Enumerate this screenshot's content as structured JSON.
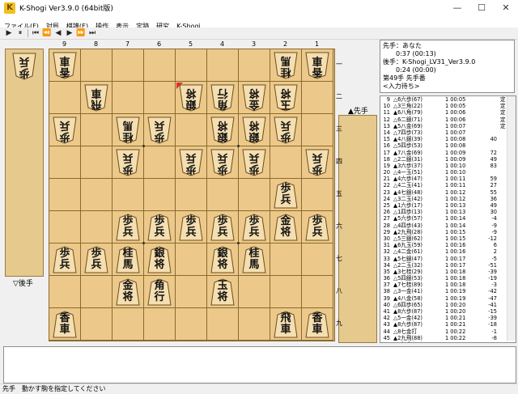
{
  "window": {
    "title": "K-Shogi Ver3.9.0 (64bit版)",
    "icon_letter": "K",
    "minimize": "—",
    "maximize": "☐",
    "close": "✕"
  },
  "menu": [
    "ファイル(F)",
    "対局",
    "棋譜(E)",
    "操作",
    "表示",
    "定跡",
    "研究",
    "K-Shogi"
  ],
  "toolbar": {
    "icons": [
      "play-icon",
      "pause-icon",
      "skip-first-icon",
      "fast-back-icon",
      "step-back-icon",
      "step-forward-icon",
      "fast-forward-icon",
      "skip-last-icon"
    ],
    "glyphs": [
      "▶",
      "⏸",
      "⏮",
      "⏪",
      "◀",
      "▶",
      "⏩",
      "⏭"
    ]
  },
  "board": {
    "file_labels": [
      "9",
      "8",
      "7",
      "6",
      "5",
      "4",
      "3",
      "2",
      "1"
    ],
    "rank_labels": [
      "一",
      "二",
      "三",
      "四",
      "五",
      "六",
      "七",
      "八",
      "九"
    ],
    "pieces": [
      {
        "f": 9,
        "r": 1,
        "c": "香",
        "l": "車",
        "side": "gote"
      },
      {
        "f": 2,
        "r": 1,
        "c": "桂",
        "l": "馬",
        "side": "gote"
      },
      {
        "f": 1,
        "r": 1,
        "c": "香",
        "l": "車",
        "side": "gote"
      },
      {
        "f": 8,
        "r": 2,
        "c": "飛",
        "l": "車",
        "side": "gote"
      },
      {
        "f": 5,
        "r": 2,
        "c": "銀",
        "l": "将",
        "side": "gote"
      },
      {
        "f": 4,
        "r": 2,
        "c": "角",
        "l": "行",
        "side": "gote"
      },
      {
        "f": 3,
        "r": 2,
        "c": "金",
        "l": "将",
        "side": "gote"
      },
      {
        "f": 2,
        "r": 2,
        "c": "玉",
        "l": "将",
        "side": "gote"
      },
      {
        "f": 9,
        "r": 3,
        "c": "歩",
        "l": "兵",
        "side": "gote"
      },
      {
        "f": 7,
        "r": 3,
        "c": "桂",
        "l": "馬",
        "side": "gote"
      },
      {
        "f": 6,
        "r": 3,
        "c": "歩",
        "l": "兵",
        "side": "gote"
      },
      {
        "f": 4,
        "r": 3,
        "c": "銀",
        "l": "将",
        "side": "gote"
      },
      {
        "f": 3,
        "r": 3,
        "c": "銀",
        "l": "将",
        "side": "gote"
      },
      {
        "f": 2,
        "r": 3,
        "c": "歩",
        "l": "兵",
        "side": "gote"
      },
      {
        "f": 7,
        "r": 4,
        "c": "歩",
        "l": "兵",
        "side": "gote"
      },
      {
        "f": 5,
        "r": 4,
        "c": "歩",
        "l": "兵",
        "side": "gote"
      },
      {
        "f": 4,
        "r": 4,
        "c": "歩",
        "l": "兵",
        "side": "gote"
      },
      {
        "f": 3,
        "r": 4,
        "c": "歩",
        "l": "兵",
        "side": "gote"
      },
      {
        "f": 1,
        "r": 4,
        "c": "歩",
        "l": "兵",
        "side": "gote"
      },
      {
        "f": 2,
        "r": 5,
        "c": "歩",
        "l": "兵",
        "side": "sente"
      },
      {
        "f": 7,
        "r": 6,
        "c": "歩",
        "l": "兵",
        "side": "sente"
      },
      {
        "f": 6,
        "r": 6,
        "c": "歩",
        "l": "兵",
        "side": "sente"
      },
      {
        "f": 5,
        "r": 6,
        "c": "歩",
        "l": "兵",
        "side": "sente"
      },
      {
        "f": 4,
        "r": 6,
        "c": "歩",
        "l": "兵",
        "side": "sente"
      },
      {
        "f": 3,
        "r": 6,
        "c": "歩",
        "l": "兵",
        "side": "sente"
      },
      {
        "f": 2,
        "r": 6,
        "c": "金",
        "l": "将",
        "side": "sente"
      },
      {
        "f": 1,
        "r": 6,
        "c": "歩",
        "l": "兵",
        "side": "sente"
      },
      {
        "f": 9,
        "r": 7,
        "c": "歩",
        "l": "兵",
        "side": "sente"
      },
      {
        "f": 8,
        "r": 7,
        "c": "歩",
        "l": "兵",
        "side": "sente"
      },
      {
        "f": 7,
        "r": 7,
        "c": "桂",
        "l": "馬",
        "side": "sente"
      },
      {
        "f": 6,
        "r": 7,
        "c": "銀",
        "l": "将",
        "side": "sente"
      },
      {
        "f": 4,
        "r": 7,
        "c": "銀",
        "l": "将",
        "side": "sente"
      },
      {
        "f": 3,
        "r": 7,
        "c": "桂",
        "l": "馬",
        "side": "sente"
      },
      {
        "f": 7,
        "r": 8,
        "c": "金",
        "l": "将",
        "side": "sente"
      },
      {
        "f": 6,
        "r": 8,
        "c": "角",
        "l": "行",
        "side": "sente"
      },
      {
        "f": 4,
        "r": 8,
        "c": "玉",
        "l": "将",
        "side": "sente"
      },
      {
        "f": 9,
        "r": 9,
        "c": "香",
        "l": "車",
        "side": "sente"
      },
      {
        "f": 2,
        "r": 9,
        "c": "飛",
        "l": "車",
        "side": "sente"
      },
      {
        "f": 1,
        "r": 9,
        "c": "香",
        "l": "車",
        "side": "sente"
      }
    ],
    "last_move": {
      "f": 5,
      "r": 2
    }
  },
  "gote_stand": {
    "label": "▽後手",
    "pieces": [
      {
        "c": "歩",
        "l": "兵"
      }
    ]
  },
  "sente_stand": {
    "label": "▲先手",
    "pieces": []
  },
  "info": {
    "line1": "先手：あなた",
    "line2": "　　0:37 (00:13)",
    "line3": "後手：K-Shogi_LV31_Ver3.9.0",
    "line4": "　　0:24 (00:00)",
    "line5": "第49手 先手番",
    "line6": "<入力待ち>"
  },
  "record": [
    {
      "n": "9",
      "m": "△6六歩(67)",
      "t": "1 00:05",
      "e": "",
      "k": "定"
    },
    {
      "n": "10",
      "m": "△3三角(22)",
      "t": "1 00:05",
      "e": "",
      "k": "定"
    },
    {
      "n": "11",
      "m": "▲6八角(79)",
      "t": "1 00:06",
      "e": "",
      "k": "定"
    },
    {
      "n": "12",
      "m": "△6二銀(71)",
      "t": "1 00:06",
      "e": "",
      "k": "定"
    },
    {
      "n": "13",
      "m": "▲5八金(69)",
      "t": "1 00:07",
      "e": "",
      "k": "定"
    },
    {
      "n": "14",
      "m": "△7四歩(73)",
      "t": "1 00:07",
      "e": "",
      "k": ""
    },
    {
      "n": "15",
      "m": "▲4八銀(39)",
      "t": "1 00:08",
      "e": "40",
      "k": ""
    },
    {
      "n": "16",
      "m": "△5四歩(53)",
      "t": "1 00:08",
      "e": "",
      "k": ""
    },
    {
      "n": "17",
      "m": "▲7八金(69)",
      "t": "1 00:09",
      "e": "72",
      "k": ""
    },
    {
      "n": "18",
      "m": "△2二銀(31)",
      "t": "1 00:09",
      "e": "49",
      "k": ""
    },
    {
      "n": "19",
      "m": "▲3六歩(37)",
      "t": "1 00:10",
      "e": "83",
      "k": ""
    },
    {
      "n": "20",
      "m": "△4一玉(51)",
      "t": "1 00:10",
      "e": "",
      "k": ""
    },
    {
      "n": "21",
      "m": "▲4六歩(47)",
      "t": "1 00:11",
      "e": "59",
      "k": ""
    },
    {
      "n": "22",
      "m": "△4二玉(41)",
      "t": "1 00:11",
      "e": "27",
      "k": ""
    },
    {
      "n": "23",
      "m": "▲4七銀(48)",
      "t": "1 00:12",
      "e": "55",
      "k": ""
    },
    {
      "n": "24",
      "m": "△3二玉(42)",
      "t": "1 00:12",
      "e": "36",
      "k": ""
    },
    {
      "n": "25",
      "m": "▲1六歩(17)",
      "t": "1 00:13",
      "e": "49",
      "k": ""
    },
    {
      "n": "26",
      "m": "△1四歩(13)",
      "t": "1 00:13",
      "e": "30",
      "k": ""
    },
    {
      "n": "27",
      "m": "▲5六歩(57)",
      "t": "1 00:14",
      "e": "-4",
      "k": ""
    },
    {
      "n": "28",
      "m": "△4四歩(43)",
      "t": "1 00:14",
      "e": "-9",
      "k": ""
    },
    {
      "n": "29",
      "m": "▲2九飛(28)",
      "t": "1 00:15",
      "e": "-9",
      "k": ""
    },
    {
      "n": "30",
      "m": "△5三銀(62)",
      "t": "1 00:15",
      "e": "-12",
      "k": ""
    },
    {
      "n": "31",
      "m": "▲6九玉(59)",
      "t": "1 00:16",
      "e": "6",
      "k": ""
    },
    {
      "n": "32",
      "m": "△4二金(61)",
      "t": "1 00:16",
      "e": "2",
      "k": ""
    },
    {
      "n": "33",
      "m": "▲5七銀(47)",
      "t": "1 00:17",
      "e": "-5",
      "k": ""
    },
    {
      "n": "34",
      "m": "△2二玉(32)",
      "t": "1 00:17",
      "e": "-51",
      "k": ""
    },
    {
      "n": "35",
      "m": "▲3七桂(29)",
      "t": "1 00:18",
      "e": "-39",
      "k": ""
    },
    {
      "n": "36",
      "m": "△5四銀(53)",
      "t": "1 00:18",
      "e": "-19",
      "k": ""
    },
    {
      "n": "37",
      "m": "▲7七桂(89)",
      "t": "1 00:18",
      "e": "-3",
      "k": ""
    },
    {
      "n": "38",
      "m": "△3一金(41)",
      "t": "1 00:19",
      "e": "-42",
      "k": ""
    },
    {
      "n": "39",
      "m": "▲4八金(58)",
      "t": "1 00:19",
      "e": "-47",
      "k": ""
    },
    {
      "n": "40",
      "m": "△6四歩(65)",
      "t": "1 00:20",
      "e": "-41",
      "k": ""
    },
    {
      "n": "41",
      "m": "▲8六歩(87)",
      "t": "1 00:20",
      "e": "-15",
      "k": ""
    },
    {
      "n": "42",
      "m": "△5一金(42)",
      "t": "1 00:21",
      "e": "-39",
      "k": ""
    },
    {
      "n": "43",
      "m": "▲8六歩(87)",
      "t": "1 00:21",
      "e": "-18",
      "k": ""
    },
    {
      "n": "44",
      "m": "△8七金打",
      "t": "1 00:22",
      "e": "-1",
      "k": ""
    },
    {
      "n": "45",
      "m": "▲2九飛(88)",
      "t": "1 00:22",
      "e": "-8",
      "k": ""
    },
    {
      "n": "46",
      "m": "△2七金(38)",
      "t": "1 00:23",
      "e": "-6",
      "k": ""
    },
    {
      "n": "47",
      "m": "▲5八金(48)",
      "t": "1 00:23",
      "e": "-71",
      "k": ""
    },
    {
      "n": "47",
      "m": "△2六金(27)",
      "t": "1 00:24",
      "e": "5",
      "k": ""
    },
    {
      "n": "48",
      "m": "△5三銀(61)",
      "t": "1 00:24",
      "e": "",
      "k": "",
      "sel": true
    }
  ],
  "status": "先手　動かす駒を指定してください"
}
